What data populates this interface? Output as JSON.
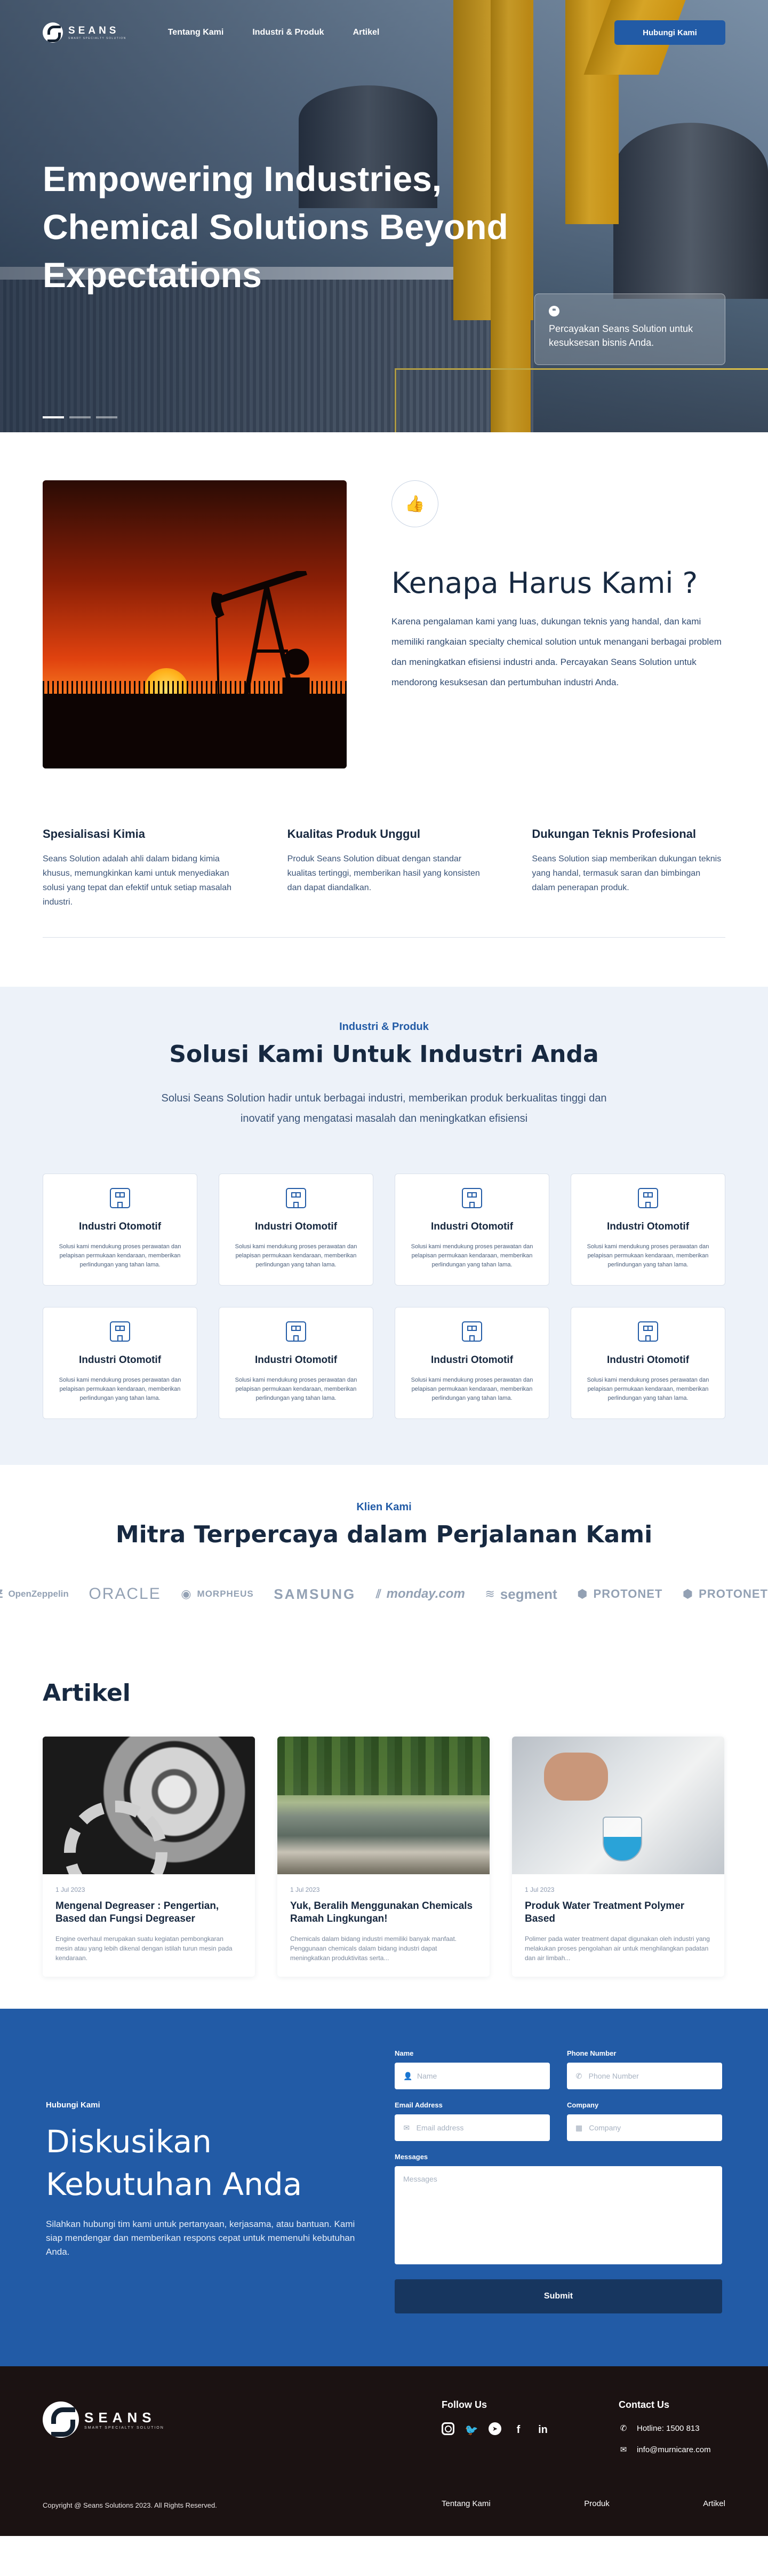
{
  "brand": {
    "name": "SEANS",
    "tagline": "SMART SPECIALTY SOLUTION"
  },
  "nav": {
    "links": [
      "Tentang Kami",
      "Industri & Produk",
      "Artikel"
    ],
    "cta": "Hubungi Kami"
  },
  "hero": {
    "title": "Empowering Industries, Chemical Solutions Beyond Expectations",
    "card_icon": "quote-icon",
    "card_text": "Percayakan Seans Solution untuk kesuksesan bisnis Anda.",
    "slides_total": 3,
    "slide_active": 1
  },
  "why": {
    "icon": "thumbs-up-icon",
    "title": "Kenapa Harus Kami ?",
    "description": "Karena pengalaman kami yang luas, dukungan teknis yang handal, dan kami memiliki rangkaian specialty chemical solution untuk menangani berbagai problem dan meningkatkan efisiensi industri anda. Percayakan Seans Solution untuk mendorong kesuksesan dan pertumbuhan industri Anda.",
    "pillars": [
      {
        "title": "Spesialisasi Kimia",
        "text": "Seans Solution adalah ahli dalam bidang kimia khusus, memungkinkan kami untuk menyediakan solusi yang tepat dan efektif untuk setiap masalah industri."
      },
      {
        "title": "Kualitas Produk Unggul",
        "text": "Produk Seans Solution dibuat dengan standar kualitas tertinggi, memberikan hasil yang konsisten dan dapat diandalkan."
      },
      {
        "title": "Dukungan Teknis Profesional",
        "text": "Seans Solution siap memberikan dukungan teknis yang handal, termasuk saran dan bimbingan dalam penerapan produk."
      }
    ]
  },
  "solusi": {
    "eyebrow": "Industri & Produk",
    "title": "Solusi Kami Untuk Industri Anda",
    "description": "Solusi Seans Solution hadir untuk berbagai industri, memberikan produk berkualitas tinggi dan inovatif yang mengatasi masalah dan meningkatkan efisiensi",
    "cards": [
      {
        "title": "Industri Otomotif",
        "text": "Solusi kami mendukung proses perawatan dan pelapisan permukaan kendaraan, memberikan perlindungan yang tahan lama."
      },
      {
        "title": "Industri Otomotif",
        "text": "Solusi kami mendukung proses perawatan dan pelapisan permukaan kendaraan, memberikan perlindungan yang tahan lama."
      },
      {
        "title": "Industri Otomotif",
        "text": "Solusi kami mendukung proses perawatan dan pelapisan permukaan kendaraan, memberikan perlindungan yang tahan lama."
      },
      {
        "title": "Industri Otomotif",
        "text": "Solusi kami mendukung proses perawatan dan pelapisan permukaan kendaraan, memberikan perlindungan yang tahan lama."
      },
      {
        "title": "Industri Otomotif",
        "text": "Solusi kami mendukung proses perawatan dan pelapisan permukaan kendaraan, memberikan perlindungan yang tahan lama."
      },
      {
        "title": "Industri Otomotif",
        "text": "Solusi kami mendukung proses perawatan dan pelapisan permukaan kendaraan, memberikan perlindungan yang tahan lama."
      },
      {
        "title": "Industri Otomotif",
        "text": "Solusi kami mendukung proses perawatan dan pelapisan permukaan kendaraan, memberikan perlindungan yang tahan lama."
      },
      {
        "title": "Industri Otomotif",
        "text": "Solusi kami mendukung proses perawatan dan pelapisan permukaan kendaraan, memberikan perlindungan yang tahan lama."
      }
    ]
  },
  "klien": {
    "eyebrow": "Klien Kami",
    "title": "Mitra Terpercaya dalam Perjalanan Kami",
    "logos": [
      "OpenZeppelin",
      "ORACLE",
      "MORPHEUS",
      "SAMSUNG",
      "monday.com",
      "segment",
      "PROTONET",
      "PROTONET"
    ]
  },
  "artikel": {
    "title": "Artikel",
    "items": [
      {
        "date": "1 Jul 2023",
        "title": "Mengenal Degreaser : Pengertian, Based dan Fungsi Degreaser",
        "excerpt": "Engine overhaul merupakan suatu kegiatan pembongkaran mesin atau yang lebih dikenal dengan istilah turun mesin pada kendaraan."
      },
      {
        "date": "1 Jul 2023",
        "title": "Yuk, Beralih Menggunakan Chemicals Ramah Lingkungan!",
        "excerpt": "Chemicals dalam bidang industri memiliki banyak manfaat. Penggunaan chemicals dalam bidang industri dapat meningkatkan produktivitas serta..."
      },
      {
        "date": "1 Jul 2023",
        "title": "Produk Water Treatment Polymer Based",
        "excerpt": "Polimer pada water treatment dapat digunakan oleh industri yang melakukan proses pengolahan air untuk menghilangkan padatan dan air limbah..."
      }
    ]
  },
  "contact": {
    "eyebrow": "Hubungi Kami",
    "title": "Diskusikan Kebutuhan Anda",
    "description": "Silahkan hubungi tim kami untuk pertanyaan, kerjasama, atau bantuan. Kami siap mendengar dan memberikan respons cepat untuk memenuhi kebutuhan Anda.",
    "fields": {
      "name": {
        "label": "Name",
        "placeholder": "Name",
        "value": ""
      },
      "phone": {
        "label": "Phone Number",
        "placeholder": "Phone Number",
        "value": ""
      },
      "email": {
        "label": "Email Address",
        "placeholder": "Email address",
        "value": ""
      },
      "company": {
        "label": "Company",
        "placeholder": "Company",
        "value": ""
      },
      "message": {
        "label": "Messages",
        "placeholder": "Messages",
        "value": ""
      }
    },
    "submit": "Submit"
  },
  "footer": {
    "follow_title": "Follow Us",
    "socials": [
      "instagram-icon",
      "twitter-icon",
      "telegram-icon",
      "facebook-icon",
      "linkedin-icon"
    ],
    "contact_title": "Contact Us",
    "hotline": "Hotline: 1500 813",
    "email": "info@murnicare.com",
    "copyright": "Copyright @ Seans Solutions 2023. All Rights Reserved.",
    "links": [
      "Tentang Kami",
      "Produk",
      "Artikel"
    ]
  },
  "colors": {
    "primary": "#225ba6",
    "navy": "#172941",
    "footer_bg": "#1b1212",
    "section_bg": "#edf2f9"
  }
}
